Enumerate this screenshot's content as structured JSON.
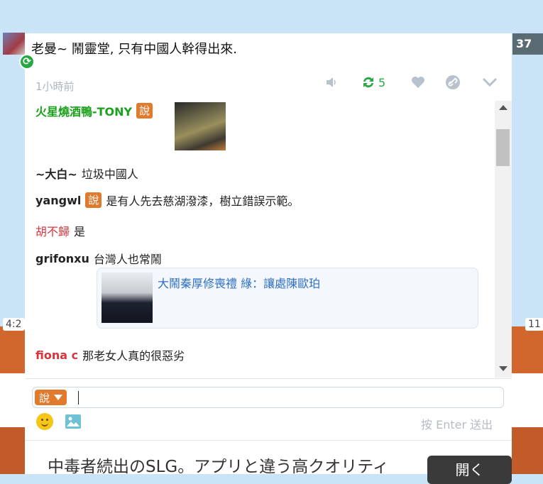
{
  "background": {
    "right_count": "37",
    "left_time": "4:2",
    "right_time": "11"
  },
  "post": {
    "text": "老曼~ 鬧靈堂, 只有中國人幹得出來.",
    "time_ago": "1小時前",
    "reshare_count": "5"
  },
  "comments": [
    {
      "user": "火星燒酒鴨-TONY",
      "tag": "說",
      "text": ""
    },
    {
      "user": "~大白~",
      "tag": "",
      "text": "垃圾中國人"
    },
    {
      "user": "yangwl",
      "tag": "說",
      "text": "是有人先去慈湖潑漆，樹立錯誤示範。"
    },
    {
      "user": "胡不歸",
      "tag": "",
      "text": "是"
    },
    {
      "user": "grifonxu",
      "tag": "",
      "text": "台灣人也常鬧"
    },
    {
      "user": "fiona c",
      "tag": "",
      "text": "那老女人真的很惡劣"
    }
  ],
  "link_card": {
    "title": "大鬧秦厚修喪禮 綠：讓處陳歐珀"
  },
  "compose": {
    "say_label": "說",
    "enter_hint": "按 Enter 送出"
  },
  "ad": {
    "text": "中毒者続出のSLG。アプリと違う高クオリティ",
    "button": "開く"
  },
  "colors": {
    "accent_orange": "#e07a2c",
    "green": "#28a745",
    "link_blue": "#2d6ec4",
    "user_red": "#d9343b",
    "user_green": "#1ba11b"
  }
}
